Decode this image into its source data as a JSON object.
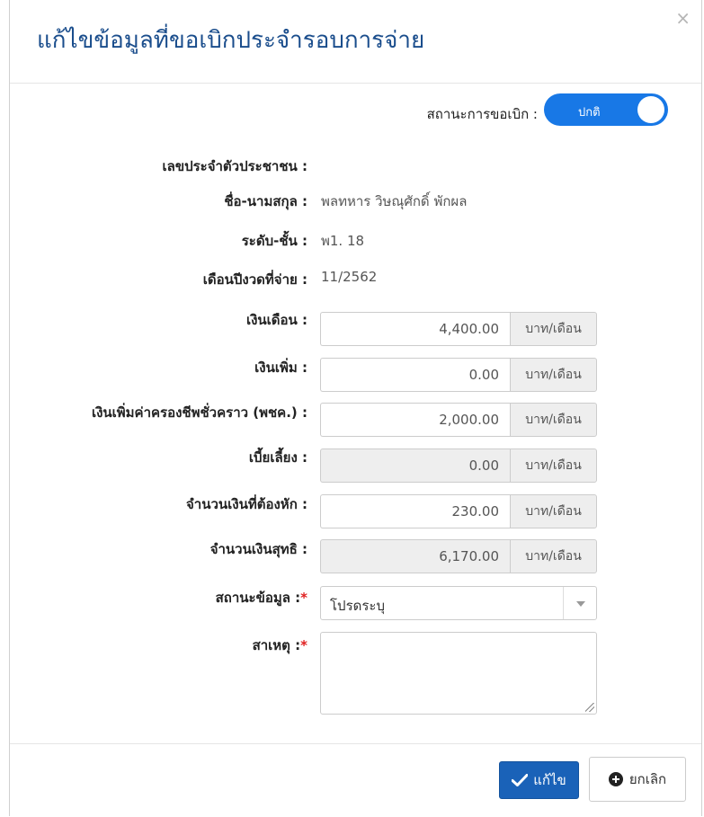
{
  "modal": {
    "title": "แก้ไขข้อมูลที่ขอเบิกประจำรอบการจ่าย",
    "close": "×"
  },
  "status": {
    "label": "สถานะการขอเบิก :",
    "toggle_text": "ปกติ",
    "toggle_on": true
  },
  "info": {
    "citizen_id_label": "เลขประจำตัวประชาชน :",
    "citizen_id_value": "",
    "name_label": "ชื่อ-นามสกุล :",
    "name_value": "พลทหาร วิษณุศักดิ์ พักผล",
    "rank_label": "ระดับ-ชั้น :",
    "rank_value": "พ1. 18",
    "period_label": "เดือนปีงวดที่จ่าย :",
    "period_value": "11/2562"
  },
  "fields": {
    "salary": {
      "label": "เงินเดือน :",
      "value": "4,400.00",
      "unit": "บาท/เดือน"
    },
    "extra": {
      "label": "เงินเพิ่ม :",
      "value": "0.00",
      "unit": "บาท/เดือน"
    },
    "temp_allowance": {
      "label": "เงินเพิ่มค่าครองชีพชั่วคราว (พชค.) :",
      "value": "2,000.00",
      "unit": "บาท/เดือน"
    },
    "stipend": {
      "label": "เบี้ยเลี้ยง :",
      "value": "0.00",
      "unit": "บาท/เดือน"
    },
    "deduction": {
      "label": "จำนวนเงินที่ต้องหัก :",
      "value": "230.00",
      "unit": "บาท/เดือน"
    },
    "net": {
      "label": "จำนวนเงินสุทธิ :",
      "value": "6,170.00",
      "unit": "บาท/เดือน"
    }
  },
  "data_status": {
    "label": "สถานะข้อมูล :",
    "required_mark": "*",
    "selected": "โปรดระบุ"
  },
  "reason": {
    "label": "สาเหตุ :",
    "required_mark": "*",
    "value": ""
  },
  "footer": {
    "edit_label": "แก้ไข",
    "cancel_label": "ยกเลิก"
  },
  "colors": {
    "title": "#1a4d8c",
    "toggle": "#1878e6",
    "primary_button": "#1a62b8",
    "required": "#e02020"
  }
}
